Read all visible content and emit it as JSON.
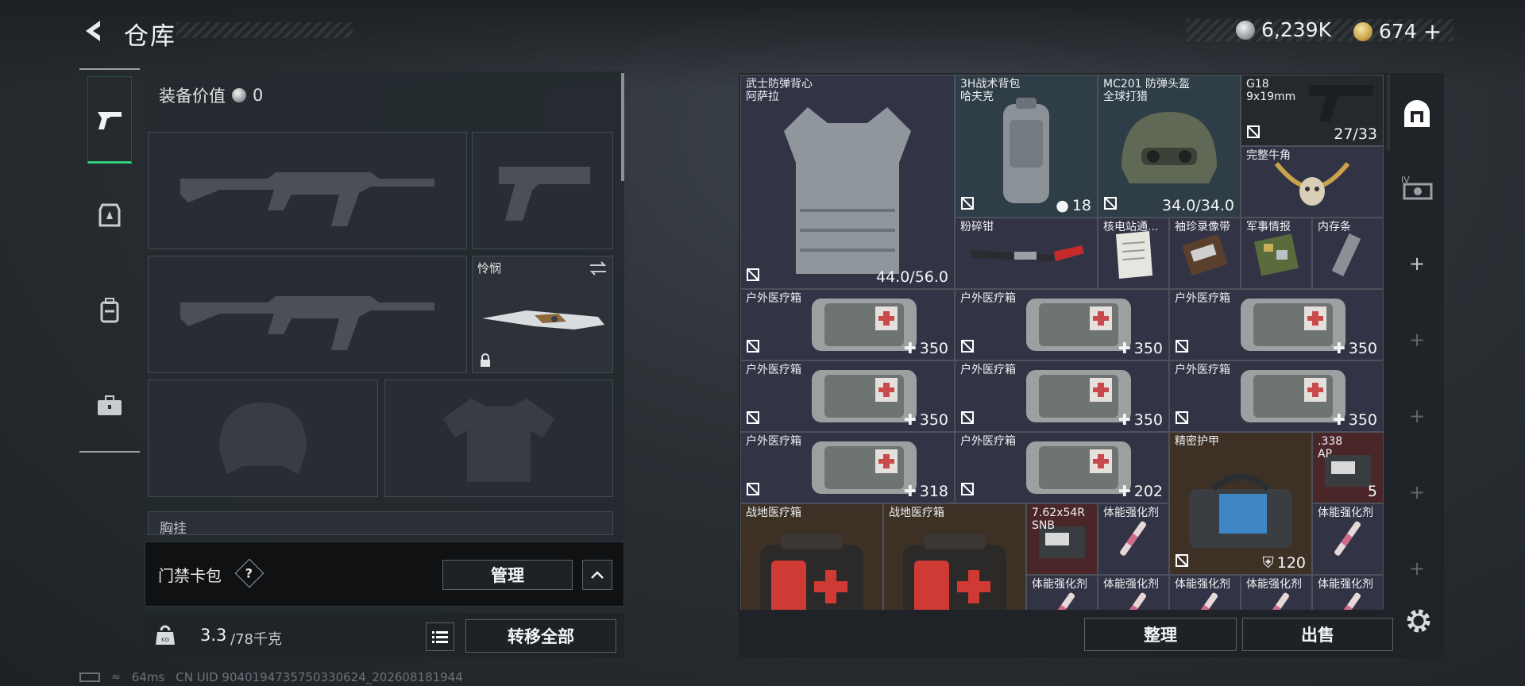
{
  "header": {
    "title": "仓库",
    "currency_silver": "6,239K",
    "currency_gold": "674",
    "add_symbol": "+"
  },
  "sidebar": {
    "items": [
      {
        "icon": "pistol-icon",
        "active": true
      },
      {
        "icon": "armor-badge-icon",
        "active": false
      },
      {
        "icon": "backpack-icon",
        "active": false
      },
      {
        "icon": "briefcase-icon",
        "active": false
      }
    ]
  },
  "loadout": {
    "equip_value_label": "装备价值",
    "equip_value": "0",
    "melee_name": "怜悯",
    "chest_rig_label": "胸挂",
    "keycard_label": "门禁卡包",
    "help_symbol": "?",
    "manage_label": "管理",
    "weight_current": "3.3",
    "weight_max": "/78千克",
    "transfer_all_label": "转移全部"
  },
  "stash": {
    "items": [
      {
        "name": "武士防弹背心\n阿萨拉",
        "value": "44.0/56.0",
        "icon": "body-armor-vest"
      },
      {
        "name": "3H战术背包\n哈夫克",
        "value": "18",
        "icon": "tactical-backpack"
      },
      {
        "name": "MC201 防弹头盔\n全球打猎",
        "value": "34.0/34.0",
        "icon": "ballistic-helmet"
      },
      {
        "name": "G18\n9x19mm",
        "value": "27/33",
        "icon": "pistol"
      },
      {
        "name": "完整牛角",
        "value": "",
        "icon": "horn-skull"
      },
      {
        "name": "粉碎钳",
        "value": "",
        "icon": "crusher-pliers"
      },
      {
        "name": "核电站通...",
        "value": "",
        "icon": "document-paper"
      },
      {
        "name": "袖珍录像带",
        "value": "",
        "icon": "cassette"
      },
      {
        "name": "军事情报",
        "value": "",
        "icon": "intel-board"
      },
      {
        "name": "内存条",
        "value": "",
        "icon": "ram-stick"
      },
      {
        "name": "户外医疗箱",
        "value": "350",
        "icon": "medkit"
      },
      {
        "name": "户外医疗箱",
        "value": "350",
        "icon": "medkit"
      },
      {
        "name": "户外医疗箱",
        "value": "350",
        "icon": "medkit"
      },
      {
        "name": "户外医疗箱",
        "value": "350",
        "icon": "medkit"
      },
      {
        "name": "户外医疗箱",
        "value": "350",
        "icon": "medkit"
      },
      {
        "name": "户外医疗箱",
        "value": "350",
        "icon": "medkit"
      },
      {
        "name": "户外医疗箱",
        "value": "318",
        "icon": "medkit"
      },
      {
        "name": "户外医疗箱",
        "value": "202",
        "icon": "medkit"
      },
      {
        "name": "精密护甲",
        "value": "120",
        "icon": "armor-bag"
      },
      {
        "name": ".338\nAP",
        "value": "5",
        "icon": "ammo-box"
      },
      {
        "name": "战地医疗箱",
        "value": "",
        "icon": "first-aid-case"
      },
      {
        "name": "战地医疗箱",
        "value": "",
        "icon": "first-aid-case"
      },
      {
        "name": "7.62x54R\nSNB",
        "value": "",
        "icon": "ammo-box"
      },
      {
        "name": "体能强化剂",
        "value": "",
        "icon": "syringe"
      },
      {
        "name": "体能强化剂",
        "value": "",
        "icon": "syringe"
      },
      {
        "name": "体能强化剂",
        "value": "",
        "icon": "syringe"
      },
      {
        "name": "体能强化剂",
        "value": "",
        "icon": "syringe"
      },
      {
        "name": "体能强化剂",
        "value": "",
        "icon": "syringe"
      },
      {
        "name": "体能强化剂",
        "value": "",
        "icon": "syringe"
      },
      {
        "name": "体能强化剂",
        "value": "",
        "icon": "syringe"
      }
    ],
    "sort_label": "整理",
    "sell_label": "出售"
  },
  "rail": {
    "items": [
      "stash-home-icon",
      "iv-container-icon",
      "add-icon",
      "add-icon",
      "add-icon",
      "add-icon",
      "add-icon"
    ]
  },
  "footer": {
    "ping": "64ms",
    "uid": "CN UID 9040194735750330624_202608181944"
  }
}
